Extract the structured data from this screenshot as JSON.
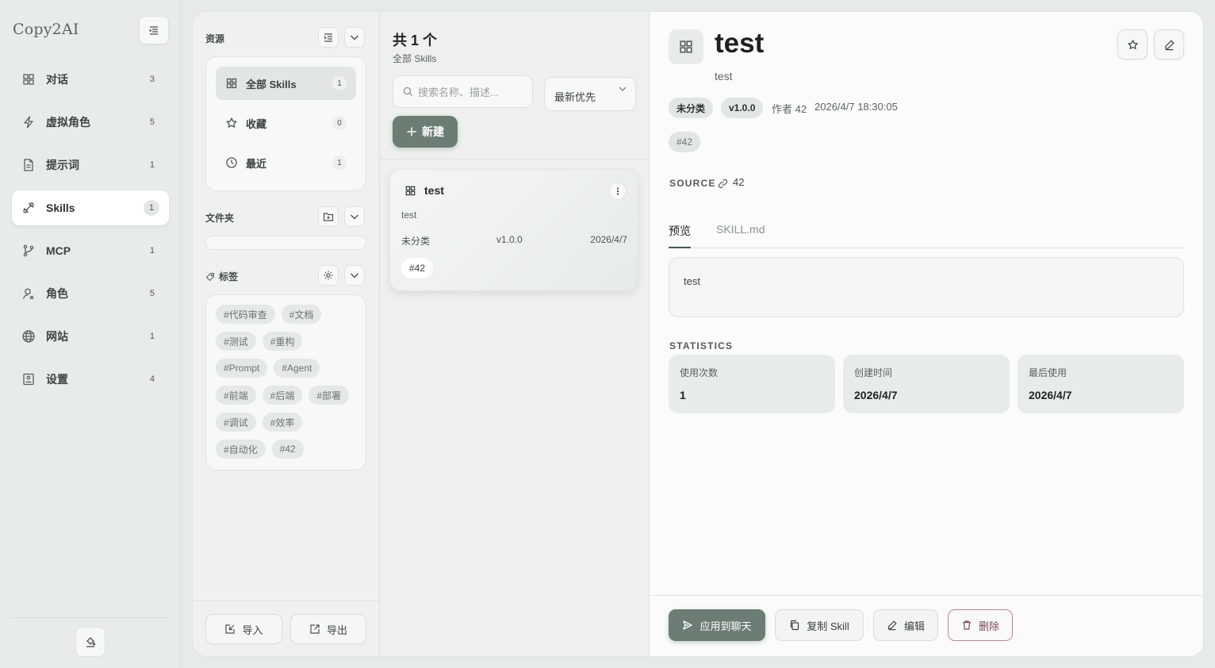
{
  "app": {
    "brand": "Copy2AI"
  },
  "nav": {
    "items": [
      {
        "label": "对话",
        "count": "3",
        "icon": "grid-icon"
      },
      {
        "label": "虚拟角色",
        "count": "5",
        "icon": "lightning-icon"
      },
      {
        "label": "提示词",
        "count": "1",
        "icon": "document-icon"
      },
      {
        "label": "Skills",
        "count": "1",
        "icon": "skill-link-icon",
        "active": true
      },
      {
        "label": "MCP",
        "count": "1",
        "icon": "branch-icon"
      },
      {
        "label": "角色",
        "count": "5",
        "icon": "user-icon"
      },
      {
        "label": "网站",
        "count": "1",
        "icon": "globe-icon"
      },
      {
        "label": "设置",
        "count": "4",
        "icon": "settings-icon"
      }
    ]
  },
  "resources": {
    "title": "资源",
    "items": [
      {
        "label": "全部 Skills",
        "count": "1",
        "active": true
      },
      {
        "label": "收藏",
        "count": "0"
      },
      {
        "label": "最近",
        "count": "1"
      }
    ],
    "folders_title": "文件夹",
    "tags_title": "标签",
    "tags": [
      "#代码审查",
      "#文档",
      "#测试",
      "#重构",
      "#Prompt",
      "#Agent",
      "#前端",
      "#后端",
      "#部署",
      "#调试",
      "#效率",
      "#自动化",
      "#42"
    ],
    "import_label": "导入",
    "export_label": "导出"
  },
  "list": {
    "count_title": "共 1 个",
    "subtitle": "全部 Skills",
    "search_placeholder": "搜索名称、描述...",
    "sort_label": "最新优先",
    "new_label": "新建",
    "cards": [
      {
        "title": "test",
        "desc": "test",
        "category": "未分类",
        "version": "v1.0.0",
        "date": "2026/4/7",
        "tag": "#42"
      }
    ]
  },
  "detail": {
    "title": "test",
    "subtitle": "test",
    "category": "未分类",
    "version": "v1.0.0",
    "author": "作者 42",
    "datetime": "2026/4/7 18:30:05",
    "tag": "#42",
    "source_label": "SOURCE",
    "source_value": "42",
    "tabs": [
      "预览",
      "SKILL.md"
    ],
    "preview_text": "test",
    "stats_label": "STATISTICS",
    "stats": [
      {
        "label": "使用次数",
        "value": "1"
      },
      {
        "label": "创建时间",
        "value": "2026/4/7"
      },
      {
        "label": "最后使用",
        "value": "2026/4/7"
      }
    ],
    "actions": {
      "apply": "应用到聊天",
      "copy": "复制 Skill",
      "edit": "编辑",
      "delete": "删除"
    }
  }
}
